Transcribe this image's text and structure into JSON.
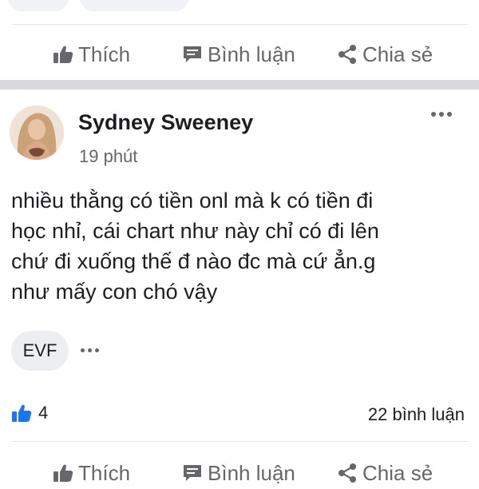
{
  "actions": {
    "like": "Thích",
    "comment": "Bình luận",
    "share": "Chia sẻ"
  },
  "post": {
    "author": "Sydney Sweeney",
    "time": "19 phút",
    "text_lines": [
      "nhiều thằng có tiền onl mà k có tiền đi",
      "học nhỉ, cái chart như này chỉ có đi lên",
      "chứ đi xuống thế đ nào đc mà cứ ẳn.g",
      "như mấy con chó vậy"
    ],
    "tag": "EVF",
    "like_count": "4",
    "comment_count": "22 bình luận"
  },
  "icons": {
    "like": "thumbs-up-icon",
    "comment": "comment-icon",
    "share": "share-icon",
    "more": "more-dots-icon"
  },
  "colors": {
    "like_accent": "#1877f2",
    "muted": "#65676b",
    "separator": "#d9dadd"
  }
}
